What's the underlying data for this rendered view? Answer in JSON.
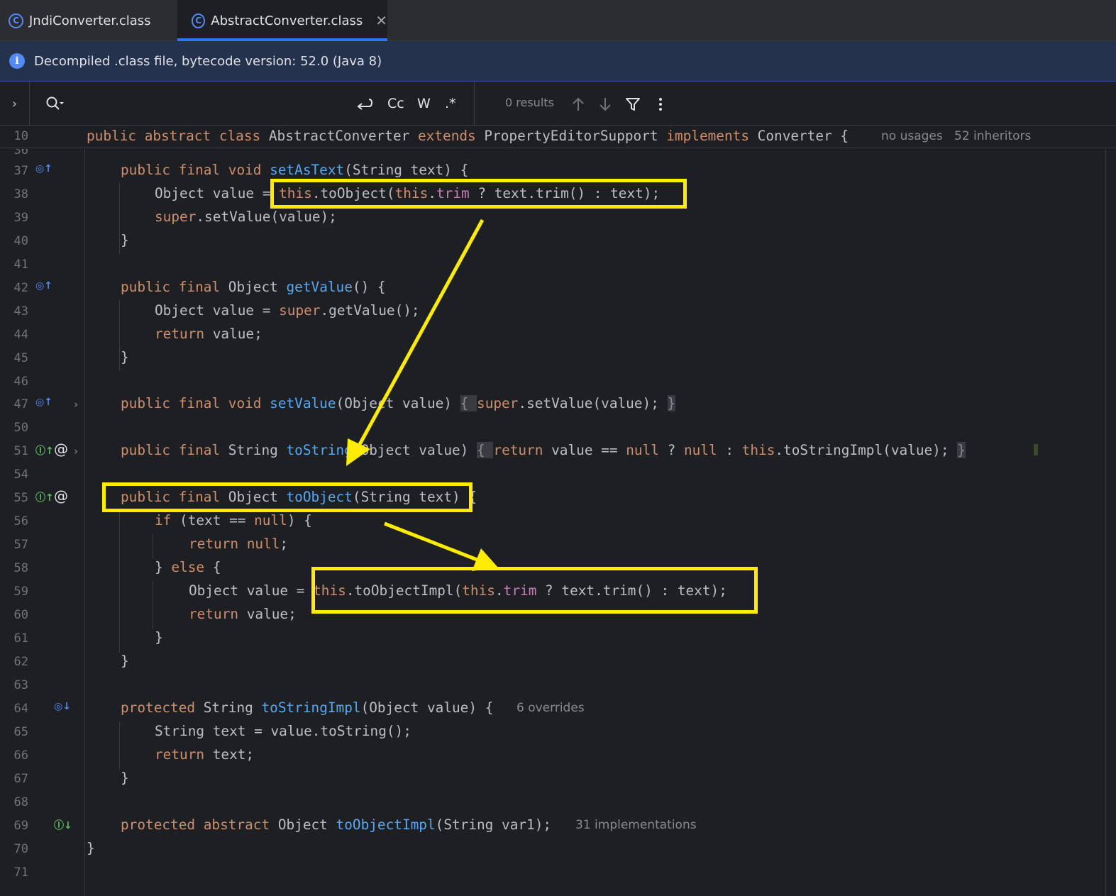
{
  "tabs": [
    {
      "label": "JndiConverter.class",
      "icon": "class-icon"
    },
    {
      "label": "AbstractConverter.class",
      "icon": "class-icon",
      "active": true
    }
  ],
  "banner": {
    "text": "Decompiled .class file, bytecode version: 52.0 (Java 8)"
  },
  "search": {
    "cc_label": "Cc",
    "w_label": "W",
    "regex_label": ".*",
    "results": "0 results"
  },
  "sticky": {
    "line_number": "10",
    "code_public": "public ",
    "code_abstract": "abstract ",
    "code_class": "class ",
    "code_name": "AbstractConverter ",
    "code_extends": "extends ",
    "code_parent": "PropertyEditorSupport ",
    "code_implements": "implements ",
    "code_iface": "Converter {",
    "hint_usages": "no usages",
    "hint_inheritors": "52 inheritors"
  },
  "line_numbers": {
    "l36": "36",
    "l37": "37",
    "l38": "38",
    "l39": "39",
    "l40": "40",
    "l41": "41",
    "l42": "42",
    "l43": "43",
    "l44": "44",
    "l45": "45",
    "l46": "46",
    "l47": "47",
    "l50": "50",
    "l51": "51",
    "l54": "54",
    "l55": "55",
    "l56": "56",
    "l57": "57",
    "l58": "58",
    "l59": "59",
    "l60": "60",
    "l61": "61",
    "l62": "62",
    "l63": "63",
    "l64": "64",
    "l65": "65",
    "l66": "66",
    "l67": "67",
    "l68": "68",
    "l69": "69",
    "l70": "70",
    "l71": "71"
  },
  "hints": {
    "overrides": "6 overrides",
    "implementations": "31 implementations"
  },
  "annotation_color": "#ffec00"
}
